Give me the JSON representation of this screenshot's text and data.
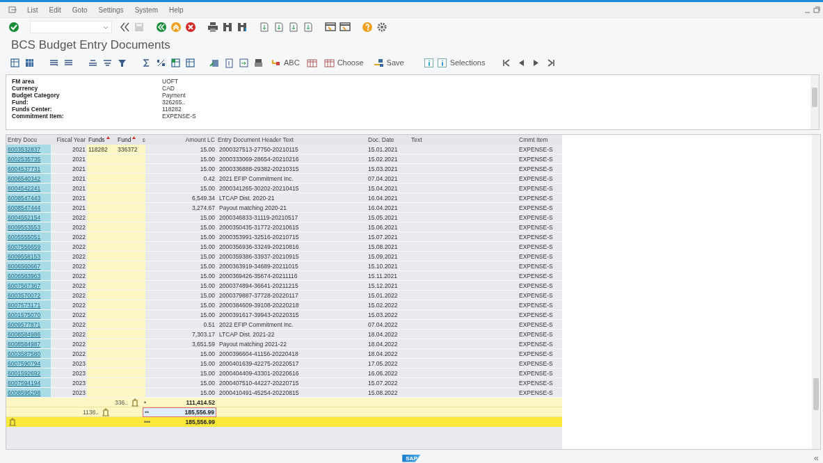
{
  "menu_bar": {
    "items": [
      "List",
      "Edit",
      "Goto",
      "Settings",
      "System",
      "Help"
    ]
  },
  "title": "BCS Budget Entry Documents",
  "app_toolbar": {
    "buttons": [
      {
        "label": "ABC",
        "kind": "icon_text"
      },
      {
        "label": "Choose",
        "kind": "icon_text"
      },
      {
        "label": "Save",
        "kind": "icon_text"
      },
      {
        "label": "Selections",
        "kind": "info_text"
      }
    ]
  },
  "header": {
    "fields": [
      {
        "label": "FM area",
        "value": "UOFT"
      },
      {
        "label": "Currency",
        "value": "CAD"
      },
      {
        "label": "Budget Category",
        "value": "Payment"
      },
      {
        "label": "Fund:",
        "value": "326265.."
      },
      {
        "label": "Funds Center:",
        "value": "118282"
      },
      {
        "label": "Commitment Item:",
        "value": "EXPENSE-S"
      }
    ]
  },
  "table": {
    "columns": [
      {
        "label": "Entry Docu",
        "sorted": false
      },
      {
        "label": "Fiscal Year",
        "sorted": false
      },
      {
        "label": "Funds",
        "sorted": true
      },
      {
        "label": "Fund",
        "sorted": true
      },
      {
        "label": "ɛ",
        "sorted": false
      },
      {
        "label": "Amount LC",
        "sorted": false
      },
      {
        "label": "Entry Document Header Text",
        "sorted": false
      },
      {
        "label": "Doc. Date",
        "sorted": false
      },
      {
        "label": "Text",
        "sorted": false
      },
      {
        "label": "Cmmt Item",
        "sorted": false
      }
    ],
    "rows": [
      {
        "entry": "6003532837",
        "year": "2021",
        "funds": "118282",
        "fund": "336372",
        "amount": "15.00",
        "header_text": "2000327513-27750-20210115",
        "doc_date": "15.01.2021",
        "cmmt_item": "EXPENSE-S"
      },
      {
        "entry": "6002535735",
        "year": "2021",
        "amount": "15.00",
        "header_text": "2000333069-28654-20210216",
        "doc_date": "15.02.2021",
        "cmmt_item": "EXPENSE-S"
      },
      {
        "entry": "6004537731",
        "year": "2021",
        "amount": "15.00",
        "header_text": "2000336888-29382-20210315",
        "doc_date": "15.03.2021",
        "cmmt_item": "EXPENSE-S"
      },
      {
        "entry": "6006540342",
        "year": "2021",
        "amount": "0.42",
        "header_text": "2021 EFIP Commitment Inc.",
        "doc_date": "07.04.2021",
        "cmmt_item": "EXPENSE-S"
      },
      {
        "entry": "6004542241",
        "year": "2021",
        "amount": "15.00",
        "header_text": "2000341265-30202-20210415",
        "doc_date": "15.04.2021",
        "cmmt_item": "EXPENSE-S"
      },
      {
        "entry": "6008547443",
        "year": "2021",
        "amount": "6,549.34",
        "header_text": "LTCAP Dist. 2020-21",
        "doc_date": "16.04.2021",
        "cmmt_item": "EXPENSE-S"
      },
      {
        "entry": "6008547444",
        "year": "2021",
        "amount": "3,274.67",
        "header_text": "Payout matching 2020-21",
        "doc_date": "16.04.2021",
        "cmmt_item": "EXPENSE-S"
      },
      {
        "entry": "6004552154",
        "year": "2022",
        "amount": "15.00",
        "header_text": "2000346833-31119-20210517",
        "doc_date": "15.05.2021",
        "cmmt_item": "EXPENSE-S"
      },
      {
        "entry": "6009553553",
        "year": "2022",
        "amount": "15.00",
        "header_text": "2000350435-31772-20210615",
        "doc_date": "15.06.2021",
        "cmmt_item": "EXPENSE-S"
      },
      {
        "entry": "6005555051",
        "year": "2022",
        "amount": "15.00",
        "header_text": "2000353991-32516-20210715",
        "doc_date": "15.07.2021",
        "cmmt_item": "EXPENSE-S"
      },
      {
        "entry": "6007556659",
        "year": "2022",
        "amount": "15.00",
        "header_text": "2000356936-33249-20210816",
        "doc_date": "15.08.2021",
        "cmmt_item": "EXPENSE-S"
      },
      {
        "entry": "6009558153",
        "year": "2022",
        "amount": "15.00",
        "header_text": "2000359386-33937-20210915",
        "doc_date": "15.09.2021",
        "cmmt_item": "EXPENSE-S"
      },
      {
        "entry": "6006560667",
        "year": "2022",
        "amount": "15.00",
        "header_text": "2000363919-34689-20211015",
        "doc_date": "15.10.2021",
        "cmmt_item": "EXPENSE-S"
      },
      {
        "entry": "6006563963",
        "year": "2022",
        "amount": "15.00",
        "header_text": "2000369426-35674-20211116",
        "doc_date": "15.11.2021",
        "cmmt_item": "EXPENSE-S"
      },
      {
        "entry": "6007567367",
        "year": "2022",
        "amount": "15.00",
        "header_text": "2000374894-36641-20211215",
        "doc_date": "15.12.2021",
        "cmmt_item": "EXPENSE-S"
      },
      {
        "entry": "6003570072",
        "year": "2022",
        "amount": "15.00",
        "header_text": "2000379887-37728-20220117",
        "doc_date": "15.01.2022",
        "cmmt_item": "EXPENSE-S"
      },
      {
        "entry": "6007573171",
        "year": "2022",
        "amount": "15.00",
        "header_text": "2000384609-39108-20220218",
        "doc_date": "15.02.2022",
        "cmmt_item": "EXPENSE-S"
      },
      {
        "entry": "6001575070",
        "year": "2022",
        "amount": "15.00",
        "header_text": "2000391617-39943-20220315",
        "doc_date": "15.03.2022",
        "cmmt_item": "EXPENSE-S"
      },
      {
        "entry": "6009577871",
        "year": "2022",
        "amount": "0.51",
        "header_text": "2022 EFIP Commitment Inc.",
        "doc_date": "07.04.2022",
        "cmmt_item": "EXPENSE-S"
      },
      {
        "entry": "6008584986",
        "year": "2022",
        "amount": "7,303.17",
        "header_text": "LTCAP Dist. 2021-22",
        "doc_date": "18.04.2022",
        "cmmt_item": "EXPENSE-S"
      },
      {
        "entry": "6008584987",
        "year": "2022",
        "amount": "3,651.59",
        "header_text": "Payout matching 2021-22",
        "doc_date": "18.04.2022",
        "cmmt_item": "EXPENSE-S"
      },
      {
        "entry": "6003587580",
        "year": "2022",
        "amount": "15.00",
        "header_text": "2000396604-41156-20220418",
        "doc_date": "18.04.2022",
        "cmmt_item": "EXPENSE-S"
      },
      {
        "entry": "6007590794",
        "year": "2023",
        "amount": "15.00",
        "header_text": "2000401639-42275-20220517",
        "doc_date": "17.05.2022",
        "cmmt_item": "EXPENSE-S"
      },
      {
        "entry": "6001592692",
        "year": "2023",
        "amount": "15.00",
        "header_text": "2000404409-43301-20220616",
        "doc_date": "16.06.2022",
        "cmmt_item": "EXPENSE-S"
      },
      {
        "entry": "6007594194",
        "year": "2023",
        "amount": "15.00",
        "header_text": "2000407510-44227-20220715",
        "doc_date": "15.07.2022",
        "cmmt_item": "EXPENSE-S"
      },
      {
        "entry": "6008596298",
        "year": "2023",
        "amount": "15.00",
        "header_text": "2000410491-45254-20220815",
        "doc_date": "15.08.2022",
        "cmmt_item": "EXPENSE-S"
      }
    ],
    "totals": [
      {
        "kind": "fund_subtotal",
        "key": "336..",
        "marker": "•",
        "amount": "111,414.52",
        "focused": false
      },
      {
        "kind": "funds_subtotal",
        "key": "1138..",
        "marker": "••",
        "amount": "185,556.99",
        "focused": true
      },
      {
        "kind": "grand_total",
        "marker": "•••",
        "amount": "185,556.99",
        "focused": false
      }
    ]
  },
  "footer": {
    "logo": "SAP",
    "collapse": "«"
  }
}
